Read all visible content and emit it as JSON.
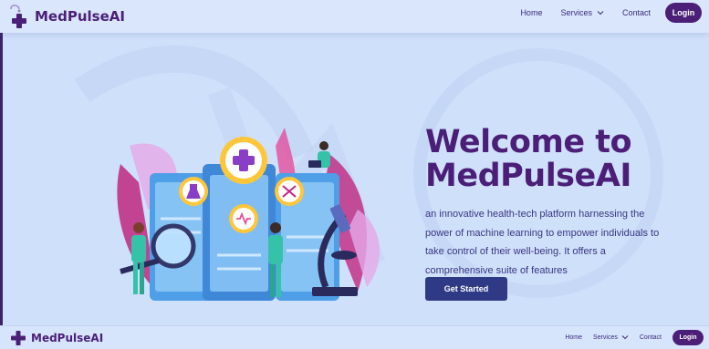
{
  "brand": {
    "name": "MedPulseAI",
    "color": "#4b1f78",
    "icon": "medical-cross-icon"
  },
  "nav": {
    "home": "Home",
    "services": "Services",
    "contact": "Contact",
    "login": "Login"
  },
  "hero": {
    "title_line1": "Welcome to",
    "title_line2": "MedPulseAI",
    "description": "an innovative health-tech platform harnessing the power of machine learning to empower individuals to take control of their well-being. It offers a comprehensive suite of features",
    "cta": "Get Started"
  },
  "footer": {
    "brand": "MedPulseAI",
    "home": "Home",
    "services": "Services",
    "contact": "Contact",
    "login": "Login"
  },
  "colors": {
    "background": "#cfe0fb",
    "accent_purple": "#4b1f78",
    "button_navy": "#2e3a86"
  }
}
